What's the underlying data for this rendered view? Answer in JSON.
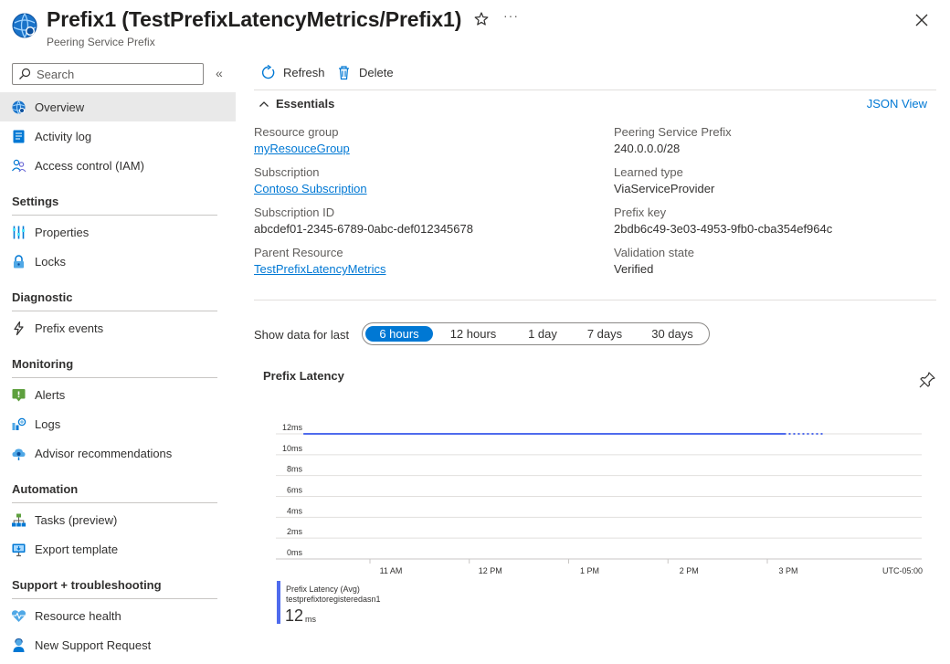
{
  "header": {
    "title": "Prefix1 (TestPrefixLatencyMetrics/Prefix1)",
    "subtitle": "Peering Service Prefix",
    "more_label": "···"
  },
  "sidebar": {
    "search_placeholder": "Search",
    "collapse_label": "«",
    "items_top": [
      {
        "label": "Overview",
        "icon": "globe-icon"
      },
      {
        "label": "Activity log",
        "icon": "activity-log-icon"
      },
      {
        "label": "Access control (IAM)",
        "icon": "people-icon"
      }
    ],
    "sections": [
      {
        "title": "Settings",
        "items": [
          {
            "label": "Properties",
            "icon": "properties-icon"
          },
          {
            "label": "Locks",
            "icon": "lock-icon"
          }
        ]
      },
      {
        "title": "Diagnostic",
        "items": [
          {
            "label": "Prefix events",
            "icon": "lightning-icon"
          }
        ]
      },
      {
        "title": "Monitoring",
        "items": [
          {
            "label": "Alerts",
            "icon": "alert-icon"
          },
          {
            "label": "Logs",
            "icon": "logs-icon"
          },
          {
            "label": "Advisor recommendations",
            "icon": "advisor-icon"
          }
        ]
      },
      {
        "title": "Automation",
        "items": [
          {
            "label": "Tasks (preview)",
            "icon": "tasks-icon"
          },
          {
            "label": "Export template",
            "icon": "export-icon"
          }
        ]
      },
      {
        "title": "Support + troubleshooting",
        "items": [
          {
            "label": "Resource health",
            "icon": "heart-icon"
          },
          {
            "label": "New Support Request",
            "icon": "support-icon"
          }
        ]
      }
    ]
  },
  "toolbar": {
    "refresh_label": "Refresh",
    "delete_label": "Delete"
  },
  "essentials": {
    "title": "Essentials",
    "json_view": "JSON View",
    "left": [
      {
        "label": "Resource group",
        "value": "myResouceGroup",
        "link": true
      },
      {
        "label": "Subscription",
        "value": "Contoso Subscription",
        "link": true
      },
      {
        "label": "Subscription ID",
        "value": "abcdef01-2345-6789-0abc-def012345678",
        "link": false
      },
      {
        "label": "Parent Resource",
        "value": "TestPrefixLatencyMetrics",
        "link": true
      }
    ],
    "right": [
      {
        "label": "Peering Service Prefix",
        "value": "240.0.0.0/28"
      },
      {
        "label": "Learned type",
        "value": "ViaServiceProvider"
      },
      {
        "label": "Prefix key",
        "value": "2bdb6c49-3e03-4953-9fb0-cba354ef964c"
      },
      {
        "label": "Validation state",
        "value": "Verified"
      }
    ]
  },
  "time_range": {
    "label": "Show data for last",
    "options": [
      "6 hours",
      "12 hours",
      "1 day",
      "7 days",
      "30 days"
    ],
    "selected": "6 hours"
  },
  "chart": {
    "title": "Prefix Latency",
    "legend_name": "Prefix Latency (Avg)",
    "legend_sub": "testprefixtoregisteredasn1",
    "legend_value": "12",
    "legend_unit": "ms",
    "line_color": "#4f6bed"
  },
  "chart_data": {
    "type": "line",
    "title": "Prefix Latency",
    "xlabel": "",
    "ylabel": "",
    "y_ticks": [
      "0ms",
      "2ms",
      "4ms",
      "6ms",
      "8ms",
      "10ms",
      "12ms"
    ],
    "ylim": [
      0,
      12
    ],
    "x_ticks": [
      "11 AM",
      "12 PM",
      "1 PM",
      "2 PM",
      "3 PM"
    ],
    "timezone_label": "UTC-05:00",
    "xlim_hours": [
      9.67,
      15.67
    ],
    "grid": true,
    "series": [
      {
        "name": "Prefix Latency (Avg)",
        "x_hours": [
          10.33,
          10.5,
          10.75,
          11,
          11.5,
          12,
          12.5,
          13,
          13.5,
          14,
          14.5,
          15,
          15.17
        ],
        "values": [
          12,
          12,
          12,
          12,
          12,
          12,
          12,
          12,
          12,
          12,
          12,
          12,
          12
        ],
        "projected_to_hour": 15.58
      }
    ]
  }
}
